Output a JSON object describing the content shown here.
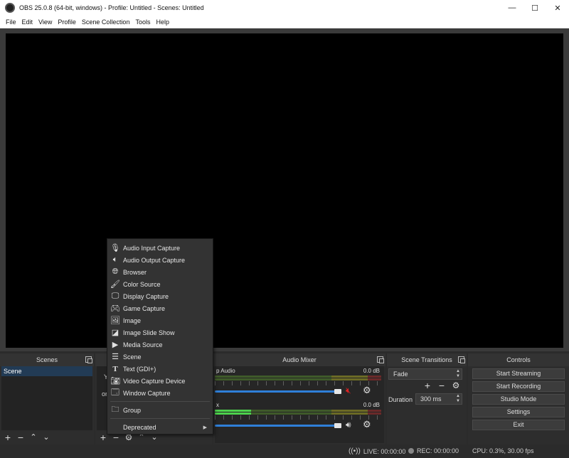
{
  "window": {
    "title": "OBS 25.0.8 (64-bit, windows) - Profile: Untitled - Scenes: Untitled",
    "minimize": "—",
    "maximize": "☐",
    "close": "✕"
  },
  "menubar": [
    "File",
    "Edit",
    "View",
    "Profile",
    "Scene Collection",
    "Tools",
    "Help"
  ],
  "scenes": {
    "header": "Scenes",
    "items": [
      "Scene"
    ]
  },
  "sources": {
    "hint_line1": "Y",
    "hint_line2": "or"
  },
  "audio_mixer": {
    "header": "Audio Mixer",
    "channels": [
      {
        "name": "p Audio",
        "db": "0.0 dB",
        "muted": true
      },
      {
        "name": "x",
        "db": "0.0 dB",
        "muted": false
      }
    ]
  },
  "scene_transitions": {
    "header": "Scene Transitions",
    "transition": "Fade",
    "duration_label": "Duration",
    "duration_value": "300 ms"
  },
  "controls": {
    "header": "Controls",
    "buttons": [
      "Start Streaming",
      "Start Recording",
      "Studio Mode",
      "Settings",
      "Exit"
    ]
  },
  "status": {
    "live": "LIVE: 00:00:00",
    "rec": "REC: 00:00:00",
    "cpu": "CPU: 0.3%, 30.00 fps"
  },
  "context_menu": {
    "items": [
      {
        "label": "Audio Input Capture",
        "icon": "microphone-icon"
      },
      {
        "label": "Audio Output Capture",
        "icon": "speaker-icon"
      },
      {
        "label": "Browser",
        "icon": "globe-icon"
      },
      {
        "label": "Color Source",
        "icon": "brush-icon"
      },
      {
        "label": "Display Capture",
        "icon": "monitor-icon"
      },
      {
        "label": "Game Capture",
        "icon": "gamepad-icon"
      },
      {
        "label": "Image",
        "icon": "image-icon"
      },
      {
        "label": "Image Slide Show",
        "icon": "slideshow-icon"
      },
      {
        "label": "Media Source",
        "icon": "play-icon"
      },
      {
        "label": "Scene",
        "icon": "list-icon"
      },
      {
        "label": "Text (GDI+)",
        "icon": "text-icon"
      },
      {
        "label": "Video Capture Device",
        "icon": "camera-icon"
      },
      {
        "label": "Window Capture",
        "icon": "window-icon"
      },
      {
        "label": "Group",
        "icon": "folder-icon"
      },
      {
        "label": "Deprecated",
        "icon": ""
      }
    ]
  }
}
